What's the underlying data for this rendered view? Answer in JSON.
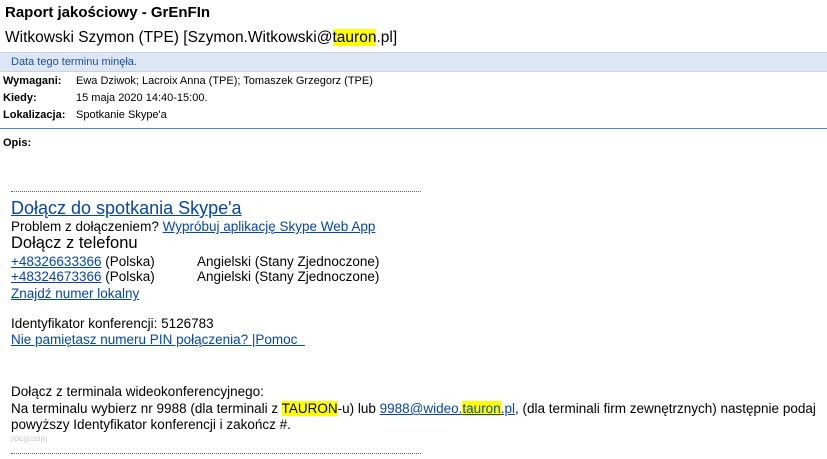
{
  "subject": "Raport jakościowy - GrEnFIn",
  "sender": {
    "prefix": "Witkowski Szymon (TPE) [Szymon.Witkowski@",
    "highlight": "tauron",
    "suffix": ".pl]"
  },
  "infobar": "Data tego terminu minęła.",
  "fields": {
    "required_label": "Wymagani:",
    "required_value": "Ewa Dziwok; Lacroix Anna (TPE); Tomaszek Grzegorz (TPE)",
    "when_label": "Kiedy:",
    "when_value": "15 maja 2020 14:40-15:00.",
    "location_label": "Lokalizacja:",
    "location_value": "Spotkanie Skype'a",
    "description_label": "Opis:"
  },
  "meeting": {
    "join_link": "Dołącz do spotkania Skype'a",
    "problem_text": "Problem z dołączeniem?",
    "webapp_link": "Wypróbuj aplikację Skype Web App",
    "phone_heading": "Dołącz z telefonu",
    "phones": [
      {
        "number": "+48326633366",
        "country": "(Polska)",
        "language": "Angielski (Stany Zjednoczone)"
      },
      {
        "number": "+48324673366",
        "country": "(Polska)",
        "language": "Angielski (Stany Zjednoczone)"
      }
    ],
    "local_number_link": "Znajdź numer lokalny",
    "conference_id": "Identyfikator konferencji: 5126783",
    "pin_link": "Nie pamiętasz numeru PIN połączenia?",
    "pipe": " |",
    "help_link": "Pomoc",
    "video_heading": "Dołącz z terminala wideokonferencyjnego:",
    "video_line1_a": "Na terminalu wybierz nr 9988 (dla terminali z ",
    "video_line1_hl": "TAURON",
    "video_line1_b": "-u) lub ",
    "video_link_a": "9988@wideo.",
    "video_link_hl": "tauron",
    "video_link_b": ".pl",
    "video_line1_c": ", (dla terminali firm zewnętrznych) następnie podaj",
    "video_line2": "powyższy Identyfikator konferencji i zakończ #.",
    "footer_code": "[!OC([1033])!]"
  }
}
